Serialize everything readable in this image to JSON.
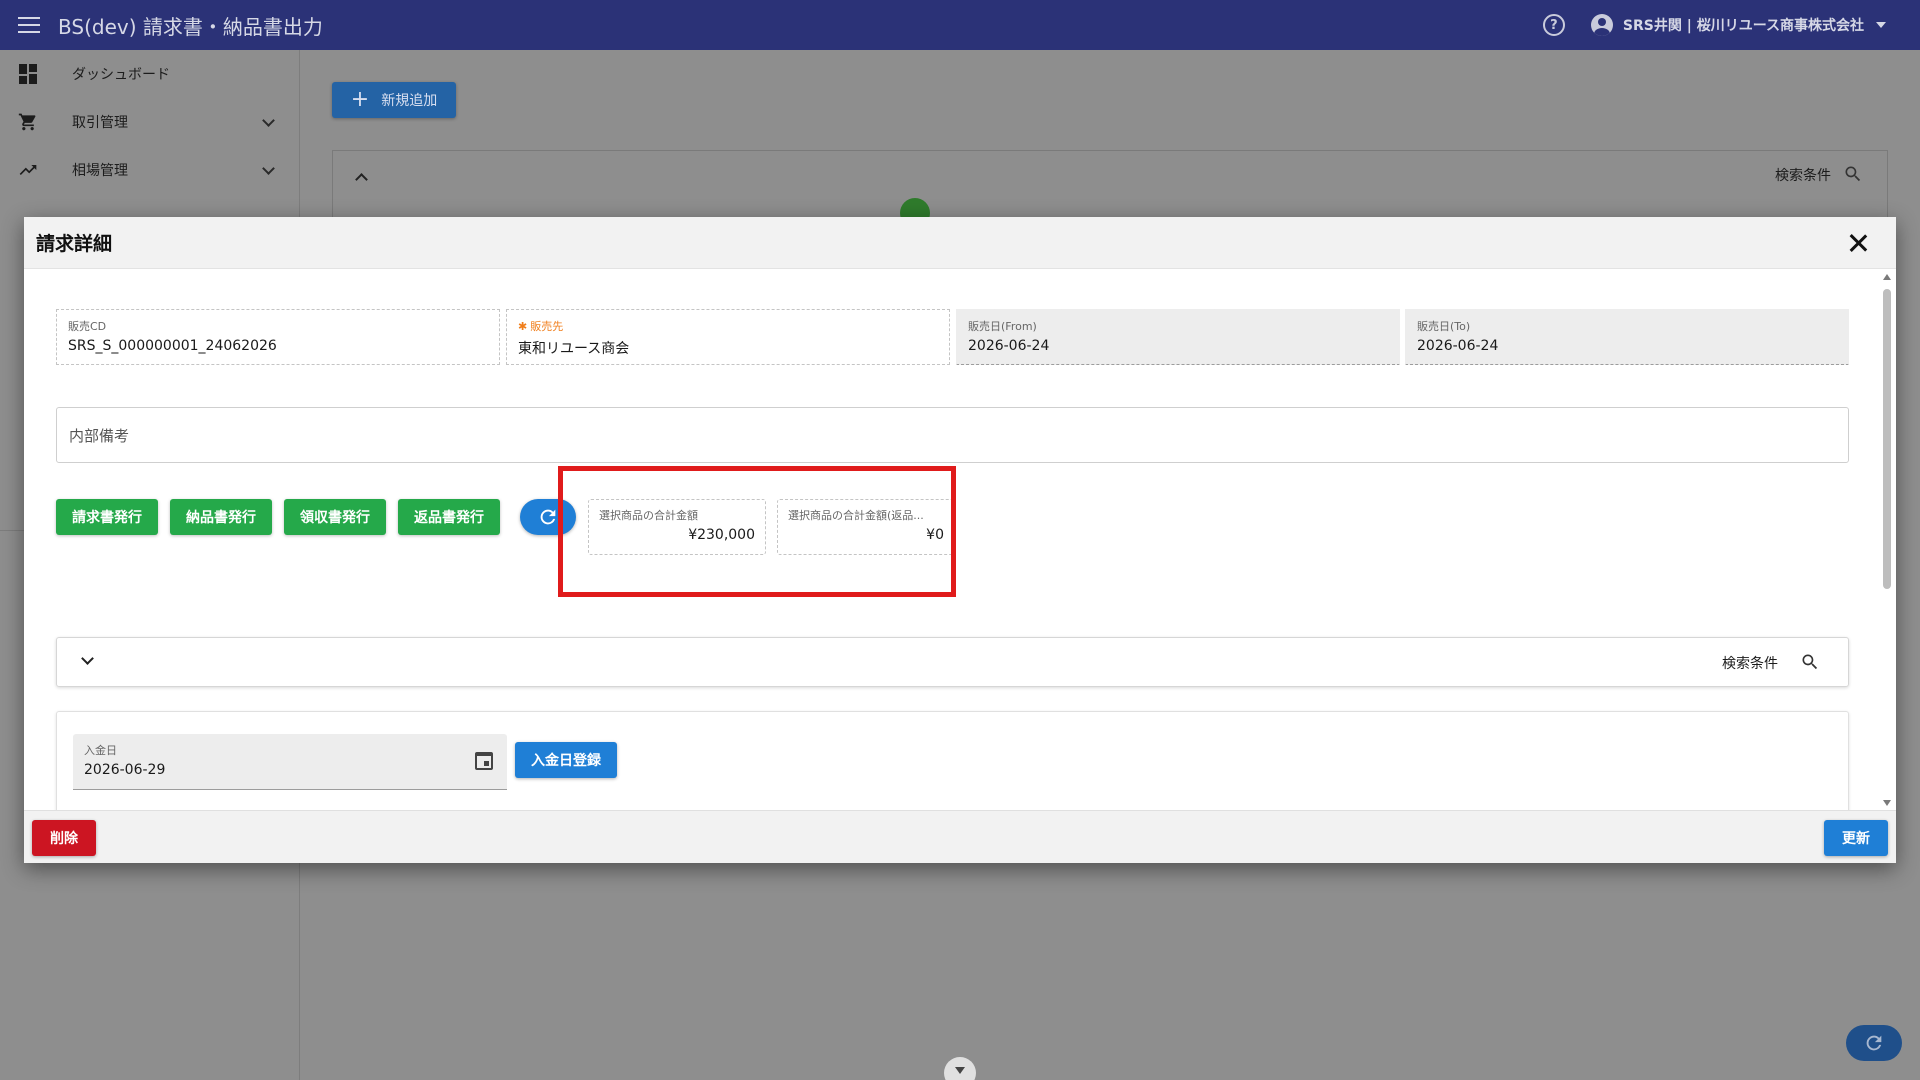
{
  "app": {
    "title": "BS(dev) 請求書・納品書出力",
    "account_name": "SRS井関 | 桜川リユース商事株式会社"
  },
  "sidebar": {
    "items": [
      {
        "label": "ダッシュボード",
        "icon": "dashboard-icon"
      },
      {
        "label": "取引管理",
        "icon": "cart-icon"
      },
      {
        "label": "相場管理",
        "icon": "trending-up-icon"
      }
    ]
  },
  "main": {
    "add_button_label": "新規追加",
    "search_condition_label": "検索条件"
  },
  "dialog": {
    "title": "請求詳細",
    "fields": {
      "sales_cd": {
        "label": "販売CD",
        "value": "SRS_S_000000001_24062026"
      },
      "customer": {
        "label": "販売先",
        "value": "東和リユース商会",
        "required_mark": "✱"
      },
      "date_from": {
        "label": "販売日(From)",
        "value": "2026-06-24"
      },
      "date_to": {
        "label": "販売日(To)",
        "value": "2026-06-24"
      }
    },
    "memo_placeholder": "内部備考",
    "action_buttons": {
      "invoice": "請求書発行",
      "delivery": "納品書発行",
      "receipt": "領収書発行",
      "return": "返品書発行"
    },
    "totals": {
      "selected_total": {
        "label": "選択商品の合計金額",
        "value": "¥230,000"
      },
      "selected_return_total": {
        "label": "選択商品の合計金額(返品...",
        "value": "¥0"
      }
    },
    "search_condition_label": "検索条件",
    "payment": {
      "label": "入金日",
      "value": "2026-06-29",
      "register_button": "入金日登録"
    },
    "footer": {
      "delete_label": "削除",
      "update_label": "更新"
    }
  },
  "colors": {
    "appbar": "#2b3277",
    "green_action": "#25a94a",
    "primary_blue": "#1f7fd6",
    "danger_red": "#cc1522",
    "highlight_red": "#e01b1b"
  }
}
